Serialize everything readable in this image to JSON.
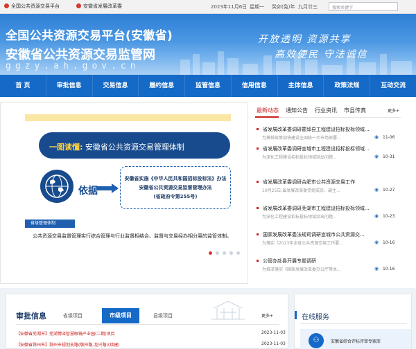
{
  "topbar": {
    "link1": "全国公共资源交易平台",
    "link2": "安徽省发展改革委",
    "date": "2023年11月6日",
    "weekday": "星期一",
    "lunar1": "癸卯(兔)年",
    "lunar2": "九月廿三",
    "search_placeholder": "搜索关键字"
  },
  "banner": {
    "title1": "全国公共资源交易平台(安徽省)",
    "title2": "安徽省公共资源交易监管网",
    "url": "ggzy.ah.gov.cn",
    "slogan1": "开放透明 资源共享",
    "slogan2": "高效便民 守法诚信"
  },
  "nav": [
    "首 页",
    "审批信息",
    "交易信息",
    "履约信息",
    "监管信息",
    "信用信息",
    "主体信息",
    "政策法规",
    "互动交流"
  ],
  "slider": {
    "headline_hi": "一图读懂:",
    "headline": "安徽省公共资源交易管理体制",
    "basis": "依据",
    "law1": "安徽省实施《中华人民共和国招标投标法》办法",
    "law2": "安徽省公共资源交易监督管理办法",
    "law3": "(省政府令第255号)",
    "tag": "省级管理体制",
    "para": "公共资源交易监督管理实行综合管理与行业监督相结合、监督与交易经办相分离的监管体制。",
    "active_dot": 1,
    "dot_count": 5
  },
  "news": {
    "tabs": [
      "最新动态",
      "通知公告",
      "行业资讯",
      "市县传真"
    ],
    "more": "更多+",
    "items": [
      {
        "title": "省发展改革委调研霍邱县工程建设招标投标领域...",
        "sub": "为摸排政策加快建设全国统一大市场部署...",
        "date": "11-06"
      },
      {
        "title": "省发展改革委调研宣城市工程建设招标投标领域...",
        "sub": "为深化工程建设招标投标领域突出问题...",
        "date": "10-31"
      },
      {
        "title": "省发展改革委调研合肥市公共资源交易工作",
        "sub": "10月25日,省发展改革委党组成员、副主...",
        "date": "10-27"
      },
      {
        "title": "省发展改革委调研芜湖市工程建设招标投标领域...",
        "sub": "为深化工程建设招标投标领域突出问题...",
        "date": "10-23"
      },
      {
        "title": "国家发展改革委法规司调研宣城市公共资源交...",
        "sub": "为落实《2023年全省公共资源交易工作要...",
        "date": "10-16"
      },
      {
        "title": "公管办赴县开展专题调研",
        "sub": "为推深落实《国家发展改革委办公厅等关...",
        "date": "10-16"
      }
    ]
  },
  "approval": {
    "heading": "审批信息",
    "tab1": "省级项目",
    "tab_active": "市级项目",
    "tab3": "县级项目",
    "more": "更多+",
    "rows": [
      {
        "title": "【安徽省芜湖市】芜湖博泽智慧眼镜产业园(二期)项目",
        "date": "2023-11-03"
      },
      {
        "title": "【安徽省滁州市】滁州市规划支路(敬梓路-龙兴路)(续建)",
        "date": "2023-11-03"
      }
    ]
  },
  "service": {
    "heading": "在线服务",
    "card": "安徽省综合评标评审专家库"
  },
  "colors": {
    "nav_blue": "#1569c7",
    "accent_red": "#c8201e",
    "headline_gold": "#ffd23f"
  }
}
